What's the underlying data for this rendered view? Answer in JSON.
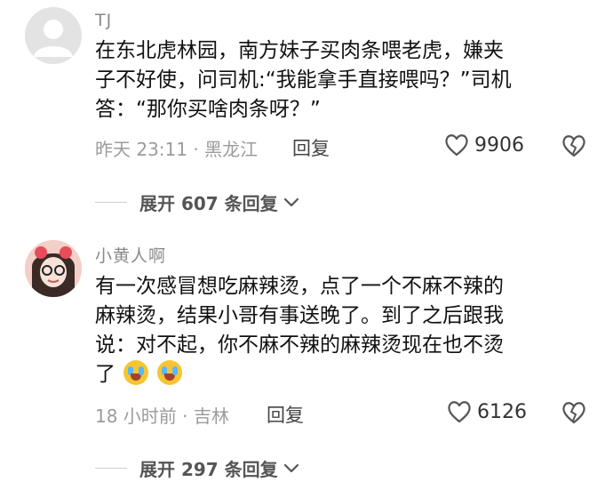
{
  "comments": [
    {
      "username": "TJ",
      "text_lines": [
        "在东北虎林园，南方妹子买肉条喂老虎，嫌夹",
        "子不好使，问司机:“我能拿手直接喂吗？”司机",
        "答：“那你买啥肉条呀？”"
      ],
      "meta": "昨天 23:11 · 黑龙江",
      "reply_label": "回复",
      "like_count": "9906",
      "expand_label": "展开 607 条回复",
      "avatar": "default-avatar-icon"
    },
    {
      "username": "小黄人啊",
      "text_lines": [
        "有一次感冒想吃麻辣烫，点了一个不麻不辣的",
        "麻辣烫，结果小哥有事送晚了。到了之后跟我",
        "说：对不起，你不麻不辣的麻辣烫现在也不烫",
        "了"
      ],
      "meta": "18 小时前 · 吉林",
      "reply_label": "回复",
      "like_count": "6126",
      "expand_label": "展开 297 条回复",
      "avatar": "user-photo-avatar",
      "emojis": [
        "crying-laughing-emoji",
        "crying-laughing-emoji"
      ]
    }
  ],
  "colors": {
    "muted": "#9b9b9b",
    "text": "#111111",
    "icon": "#555555"
  }
}
